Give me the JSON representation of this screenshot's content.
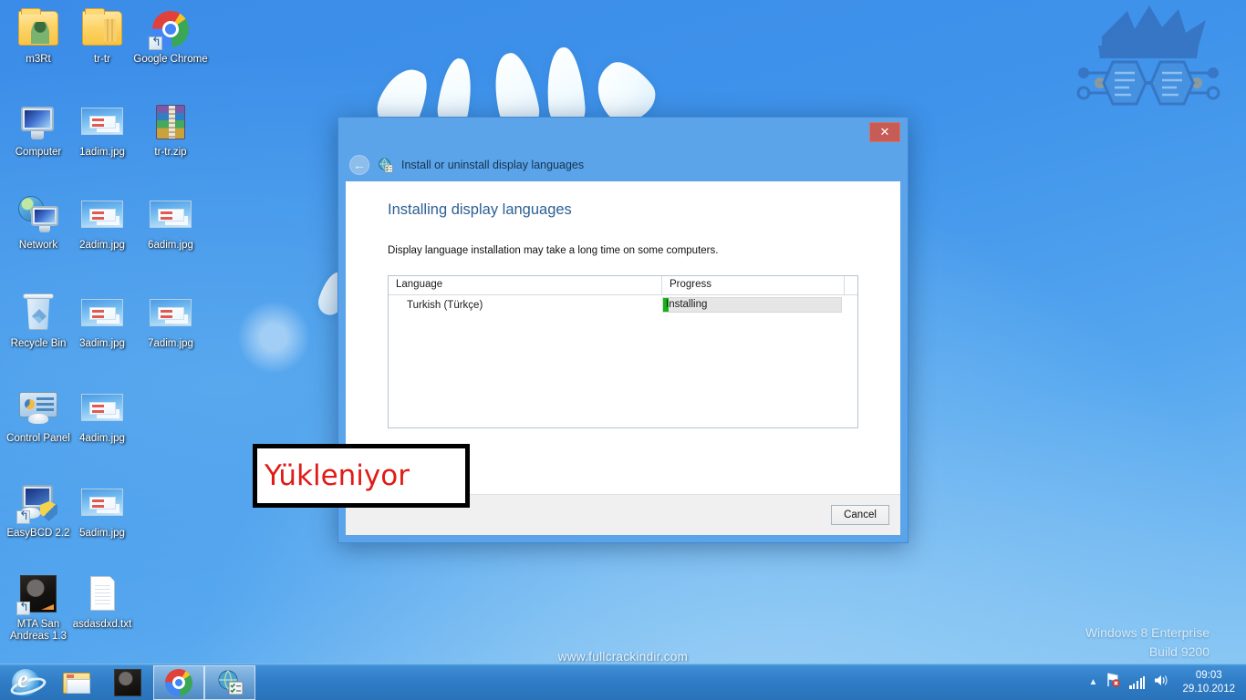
{
  "desktop": {
    "icons": [
      {
        "label": "m3Rt",
        "art": "folder-person",
        "shortcut": false
      },
      {
        "label": "tr-tr",
        "art": "folder-lines",
        "shortcut": false
      },
      {
        "label": "Google Chrome",
        "art": "chrome",
        "shortcut": true
      },
      {
        "label": "Computer",
        "art": "monitor",
        "shortcut": false
      },
      {
        "label": "1adim.jpg",
        "art": "jpg",
        "shortcut": false
      },
      {
        "label": "tr-tr.zip",
        "art": "zip",
        "shortcut": false
      },
      {
        "label": "Network",
        "art": "network",
        "shortcut": false
      },
      {
        "label": "2adim.jpg",
        "art": "jpg",
        "shortcut": false
      },
      {
        "label": "6adim.jpg",
        "art": "jpg",
        "shortcut": false
      },
      {
        "label": "Recycle Bin",
        "art": "bin",
        "shortcut": false
      },
      {
        "label": "3adim.jpg",
        "art": "jpg",
        "shortcut": false
      },
      {
        "label": "7adim.jpg",
        "art": "jpg",
        "shortcut": false
      },
      {
        "label": "Control Panel",
        "art": "cpanel",
        "shortcut": false
      },
      {
        "label": "4adim.jpg",
        "art": "jpg",
        "shortcut": false
      },
      {
        "label": "EasyBCD 2.2",
        "art": "easybcd",
        "shortcut": true
      },
      {
        "label": "5adim.jpg",
        "art": "jpg",
        "shortcut": false
      },
      {
        "label": "MTA San Andreas 1.3",
        "art": "mta",
        "shortcut": true
      },
      {
        "label": "asdasdxd.txt",
        "art": "txt",
        "shortcut": false
      }
    ],
    "site_watermark": "www.fullcrackindir.com",
    "windows_brand_line1": "Windows 8 Enterprise",
    "windows_brand_line2": "Build 9200"
  },
  "dialog": {
    "titlebar": {
      "title": "Install or uninstall display languages",
      "icon_name": "display-languages-icon",
      "back_label": "←",
      "close_label": "✕",
      "close_color": "#c75b55"
    },
    "heading": "Installing display languages",
    "description": "Display language installation may take a long time on some computers.",
    "table": {
      "columns": [
        "Language",
        "Progress"
      ],
      "rows": [
        {
          "language": "Turkish (Türkçe)",
          "progress_label": "Installing",
          "progress_percent": 3,
          "progress_color": "#13b514",
          "track_color": "#e6e6e6"
        }
      ]
    },
    "footer": {
      "cancel_label": "Cancel"
    }
  },
  "annotation": {
    "text": "Yükleniyor",
    "text_color": "#e01b17",
    "border_color": "#000000"
  },
  "taskbar": {
    "buttons": [
      {
        "name": "internet-explorer",
        "art": "ie",
        "open": false
      },
      {
        "name": "file-explorer",
        "art": "explorer",
        "open": false
      },
      {
        "name": "mta-san-andreas",
        "art": "mta",
        "open": false
      },
      {
        "name": "google-chrome",
        "art": "chrome",
        "open": true
      },
      {
        "name": "display-languages",
        "art": "lang",
        "open": true
      }
    ],
    "tray": {
      "chevron": "▲",
      "action_center_icon": "flag-warning-icon",
      "network_icon": "network-bars-icon",
      "volume_icon": "speaker-icon",
      "clock_time": "09:03",
      "clock_date": "29.10.2012"
    }
  }
}
